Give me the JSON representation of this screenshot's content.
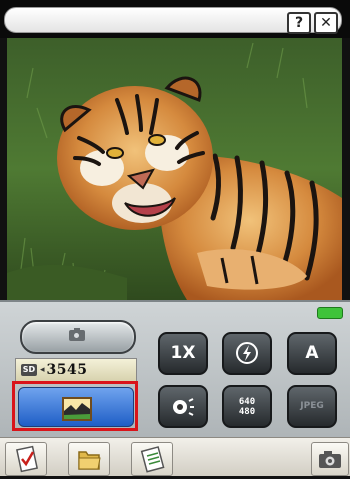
{
  "title_bar": {
    "help_icon": "question-mark",
    "close_icon": "x",
    "help_glyph": "?",
    "close_glyph": "✕"
  },
  "viewfinder": {
    "subject": "tiger-photo"
  },
  "controls": {
    "shutter_icon": "camera-icon",
    "storage": {
      "media_label": "SD",
      "arrow": "◂",
      "remaining_shots": "3545"
    },
    "mode_button_icon": "landscape-picture-icon",
    "mode_button_highlight_color": "#d9141a",
    "zoom_label": "1X",
    "flash_icon": "flash-off-icon",
    "flash_glyph": "⚡",
    "white_balance_label": "A",
    "macro_icon": "macro-icon",
    "resolution_label_top": "640",
    "resolution_label_bottom": "480",
    "format_label": "JPEG",
    "status_led_color": "#3fc33a"
  },
  "taskbar": {
    "items": [
      {
        "name": "clipboard",
        "icon": "clipboard-check-icon"
      },
      {
        "name": "folder",
        "icon": "folder-icon"
      },
      {
        "name": "notes",
        "icon": "notepad-icon"
      },
      {
        "name": "camera",
        "icon": "camera-icon"
      }
    ]
  }
}
